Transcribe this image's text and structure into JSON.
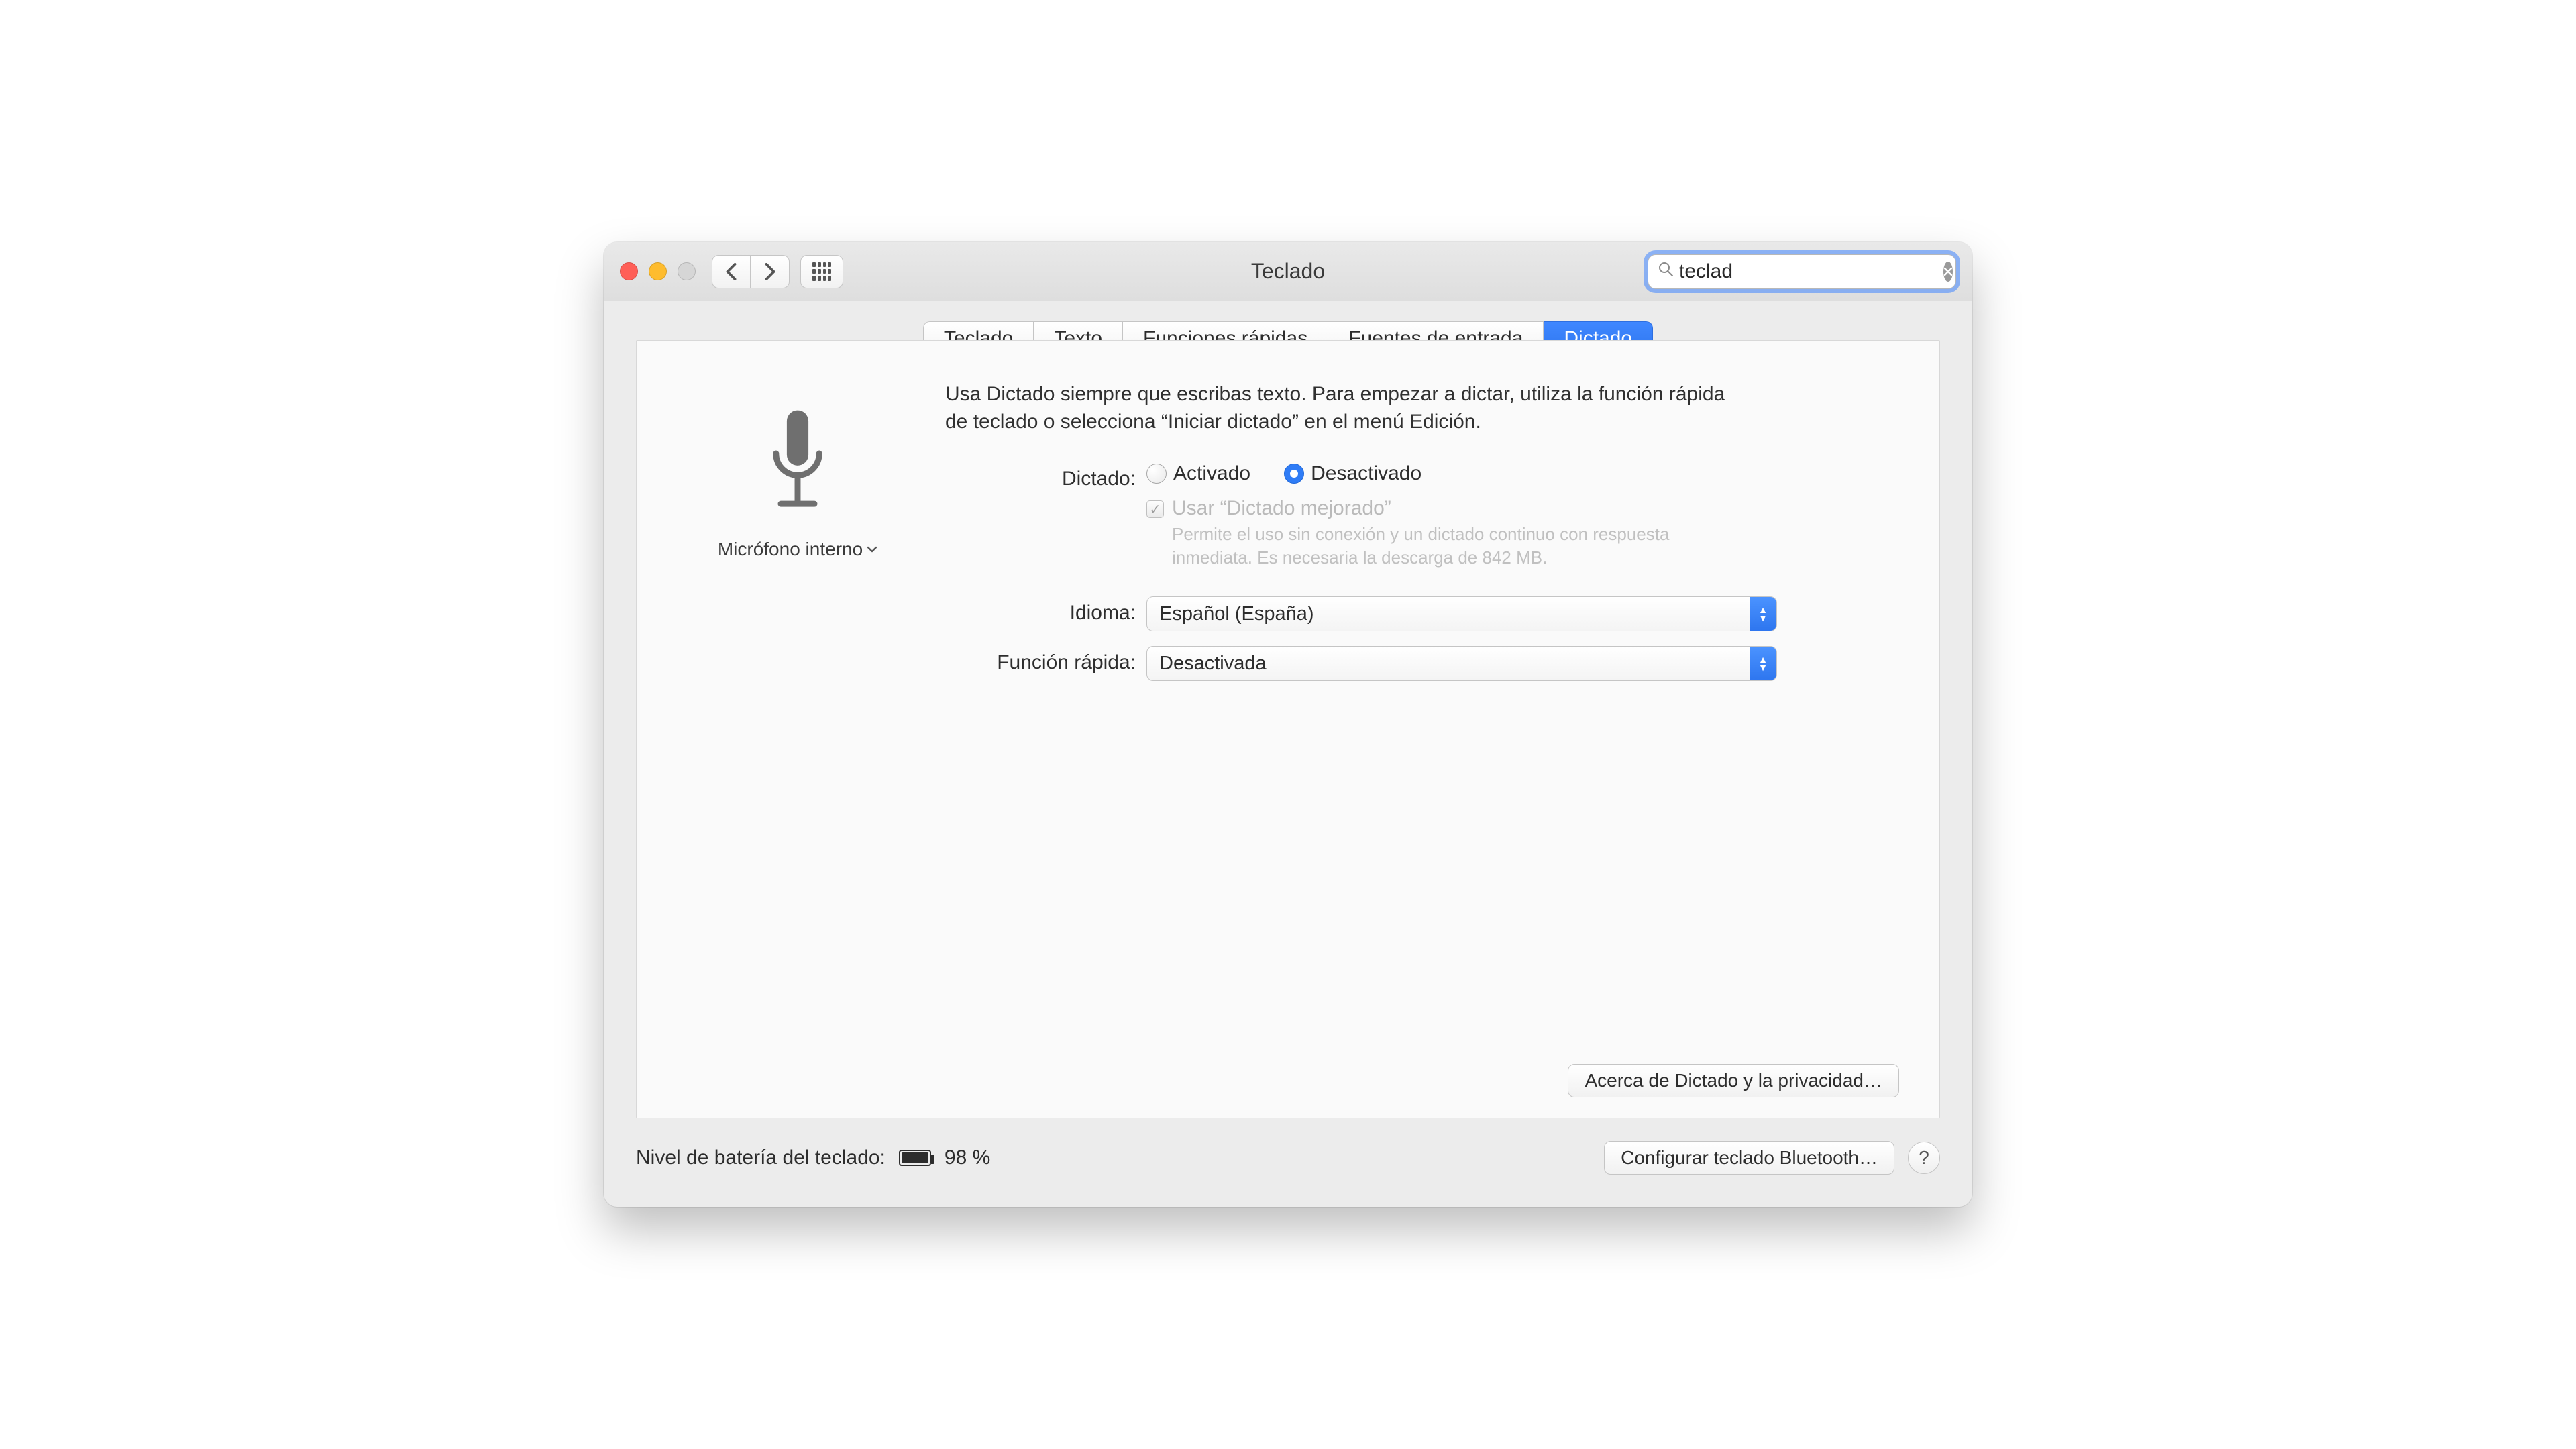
{
  "window": {
    "title": "Teclado"
  },
  "toolbar": {
    "search_value": "teclad"
  },
  "tabs": [
    {
      "label": "Teclado",
      "active": false
    },
    {
      "label": "Texto",
      "active": false
    },
    {
      "label": "Funciones rápidas",
      "active": false
    },
    {
      "label": "Fuentes de entrada",
      "active": false
    },
    {
      "label": "Dictado",
      "active": true
    }
  ],
  "mic": {
    "label": "Micrófono interno"
  },
  "desc": "Usa Dictado siempre que escribas texto. Para empezar a dictar, utiliza la función rápida de teclado o selecciona “Iniciar dictado” en el menú Edición.",
  "dictation": {
    "row_label": "Dictado:",
    "on_label": "Activado",
    "off_label": "Desactivado",
    "selected": "off",
    "enhanced_label": "Usar “Dictado mejorado”",
    "enhanced_desc": "Permite el uso sin conexión y un dictado continuo con respuesta inmediata. Es necesaria la descarga de 842 MB.",
    "enhanced_checked": true,
    "enhanced_enabled": false
  },
  "language": {
    "row_label": "Idioma:",
    "value": "Español (España)"
  },
  "shortcut": {
    "row_label": "Función rápida:",
    "value": "Desactivada"
  },
  "privacy_button": "Acerca de Dictado y la privacidad…",
  "footer": {
    "battery_label": "Nivel de batería del teclado:",
    "battery_pct": "98 %",
    "bluetooth_button": "Configurar teclado Bluetooth…",
    "help": "?"
  }
}
